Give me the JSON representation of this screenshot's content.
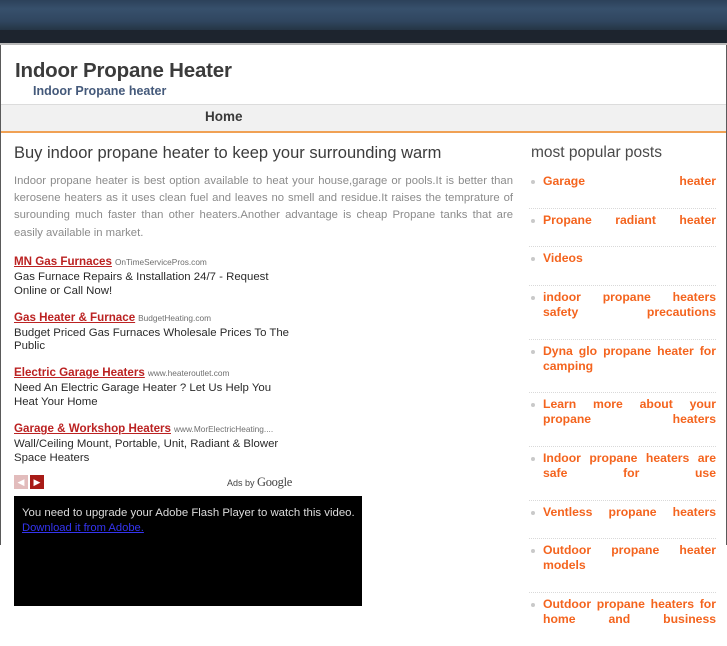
{
  "site": {
    "title": "Indoor Propane Heater",
    "tagline": "Indoor Propane heater"
  },
  "nav": {
    "items": [
      {
        "label": "Home"
      }
    ]
  },
  "article": {
    "heading": "Buy indoor propane heater to keep your surrounding warm",
    "body": "Indoor propane heater is best option available to heat your house,garage or pools.It is better than kerosene heaters as it uses clean fuel and leaves no smell and residue.It raises the temprature of surounding much faster than other heaters.Another advantage is cheap Propane tanks that are easily available in market."
  },
  "ads": {
    "units": [
      {
        "title": "MN Gas Furnaces",
        "domain": "OnTimeServicePros.com",
        "description": "Gas Furnace Repairs & Installation 24/7 - Request Online or Call Now!"
      },
      {
        "title": "Gas Heater & Furnace",
        "domain": "BudgetHeating.com",
        "description": "Budget Priced Gas Furnaces Wholesale Prices To The Public"
      },
      {
        "title": "Electric Garage Heaters",
        "domain": "www.heateroutlet.com",
        "description": "Need An Electric Garage Heater ? Let Us Help You Heat Your Home"
      },
      {
        "title": "Garage & Workshop Heaters",
        "domain": "www.MorElectricHeating....",
        "description": "Wall/Ceiling Mount, Portable, Unit, Radiant & Blower Space Heaters"
      }
    ],
    "prev_arrow": "◀",
    "next_arrow": "▶",
    "attribution_prefix": "Ads by ",
    "attribution_brand": "Google"
  },
  "video": {
    "message": "You need to upgrade your Adobe Flash Player to watch this video.",
    "download_link": "Download it from Adobe."
  },
  "sidebar": {
    "heading": "most popular posts",
    "posts": [
      {
        "label": "Garage heater"
      },
      {
        "label": "Propane radiant heater"
      },
      {
        "label": "Videos"
      },
      {
        "label": "indoor propane heaters safety precautions"
      },
      {
        "label": "Dyna glo propane heater for camping"
      },
      {
        "label": "Learn more about your propane heaters"
      },
      {
        "label": "Indoor propane heaters are safe for use"
      },
      {
        "label": "Ventless propane heaters"
      },
      {
        "label": "Outdoor propane heater models"
      },
      {
        "label": "Outdoor propane heaters for home and business"
      }
    ]
  },
  "colors": {
    "accent_orange": "#f4641e",
    "nav_underline": "#f0a154",
    "ad_title_red": "#bb2222",
    "header_dark": "#1d242e"
  }
}
